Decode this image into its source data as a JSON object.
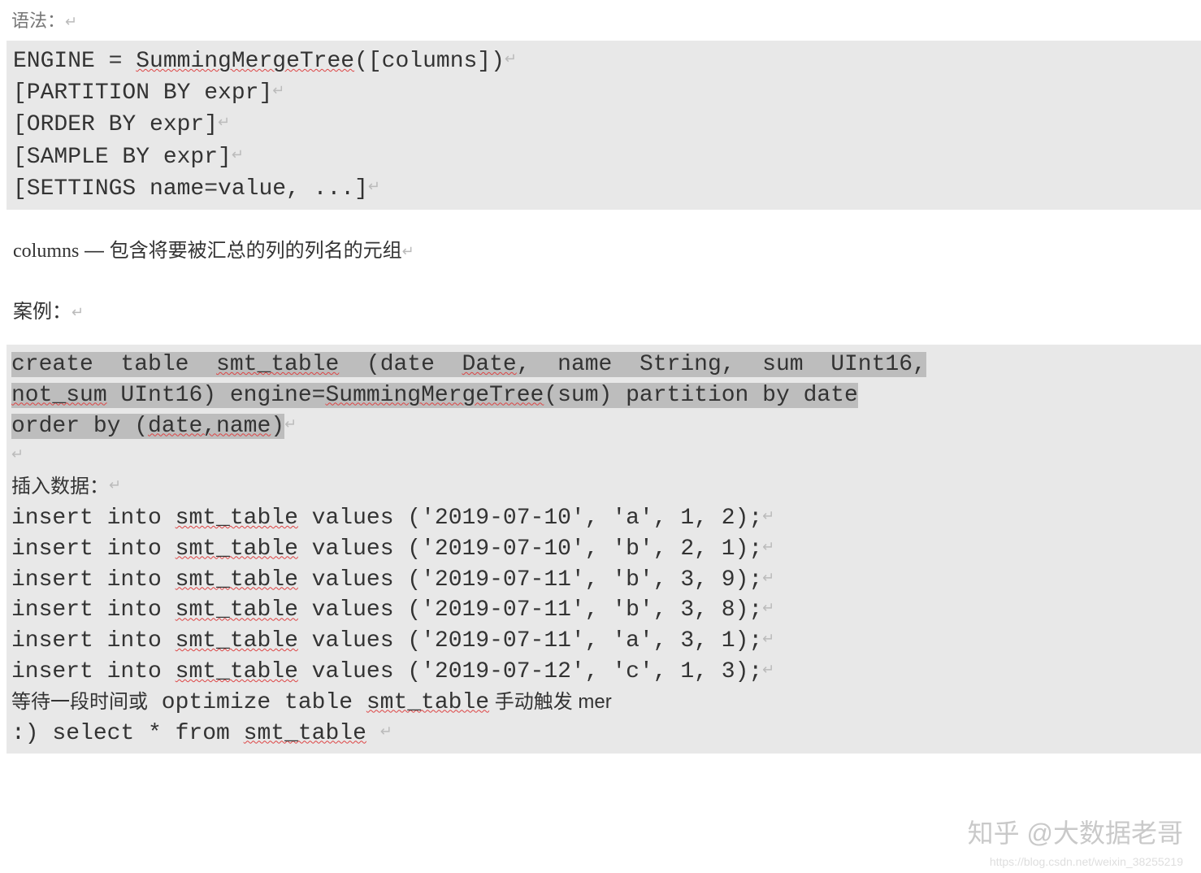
{
  "syntax_label": "语法：",
  "ret": "↵",
  "code1": {
    "l1_a": "ENGINE = ",
    "l1_b": "SummingMergeTree",
    "l1_c": "([columns])",
    "l2": "[PARTITION BY expr]",
    "l3": "[ORDER BY expr]",
    "l4": "[SAMPLE BY expr]",
    "l5": "[SETTINGS name=value, ...]"
  },
  "desc": {
    "key": "columns",
    "dash": " — ",
    "text": "包含将要被汇总的列的列名的元组"
  },
  "case_label": "案例：",
  "code2": {
    "hl_l1_a": "create  table  ",
    "hl_l1_b": "smt_table",
    "hl_l1_c": "  (date  ",
    "hl_l1_d": "Date",
    "hl_l1_e": ",  name  String,  sum  UInt16,",
    "hl_l2_a": "not_sum",
    "hl_l2_b": " UInt16) engine=",
    "hl_l2_c": "SummingMergeTree",
    "hl_l2_d": "(sum) partition by date",
    "hl_l3_a": "order by (",
    "hl_l3_b": "date,name",
    "hl_l3_c": ")",
    "blank": " ",
    "insert_label": "插入数据：",
    "ins_pre": "insert into ",
    "ins_tbl": "smt_table",
    "ins1": " values ('2019-07-10', 'a', 1, 2);",
    "ins2": " values ('2019-07-10', 'b', 2, 1);",
    "ins3": " values ('2019-07-11', 'b', 3, 9);",
    "ins4": " values ('2019-07-11', 'b', 3, 8);",
    "ins5": " values ('2019-07-11', 'a', 3, 1);",
    "ins6": " values ('2019-07-12', 'c', 1, 3);",
    "wait_a": "等待一段时间或",
    "wait_b": " optimize table ",
    "wait_c": "smt_table",
    "wait_d": " 手动触发 mer",
    "sel_a": ":) select * from ",
    "sel_b": "smt_table"
  },
  "watermark": "知乎 @大数据老哥",
  "watermark_url": "https://blog.csdn.net/weixin_38255219"
}
